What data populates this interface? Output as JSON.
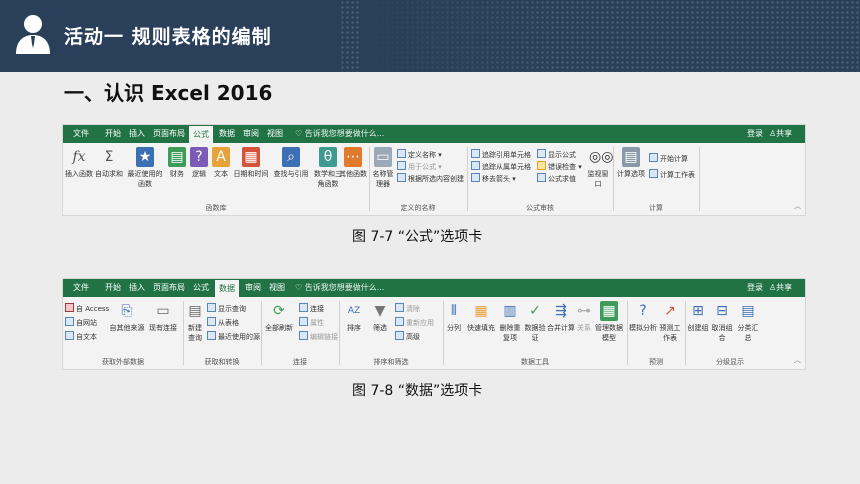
{
  "header": {
    "title": "活动一  规则表格的编制",
    "avatar_icon": "user-icon"
  },
  "section_title": "一、认识 Excel 2016",
  "ribbon1": {
    "tabs": [
      "文件",
      "开始",
      "插入",
      "页面布局",
      "公式",
      "数据",
      "审阅",
      "视图"
    ],
    "active_tab": "公式",
    "tell_me": "告诉我您想要做什么...",
    "login": "登录",
    "share": "共享",
    "buttons": [
      {
        "label": "插入函数",
        "icon": "fx",
        "color": "#555555"
      },
      {
        "label": "自动求和",
        "icon": "Σ",
        "color": "#555555"
      },
      {
        "label": "最近使用的函数",
        "icon": "★",
        "color": "#3d6fb5"
      },
      {
        "label": "财务",
        "icon": "▤",
        "color": "#3f9b5a"
      },
      {
        "label": "逻辑",
        "icon": "?",
        "color": "#7b5bb5"
      },
      {
        "label": "文本",
        "icon": "A",
        "color": "#e8a23a"
      },
      {
        "label": "日期和时间",
        "icon": "▦",
        "color": "#d4543a"
      },
      {
        "label": "查找与引用",
        "icon": "⌕",
        "color": "#3d6fb5"
      },
      {
        "label": "数学和三角函数",
        "icon": "θ",
        "color": "#3f9b8f"
      },
      {
        "label": "其他函数",
        "icon": "⋯",
        "color": "#e07a2e"
      }
    ],
    "names": {
      "manager": "名称管理器",
      "define": "定义名称",
      "use": "用于公式",
      "create": "根据所选内容创建"
    },
    "audit": [
      "追踪引用单元格",
      "追踪从属单元格",
      "移去箭头",
      "显示公式",
      "错误检查",
      "公式求值"
    ],
    "watch": "监视窗口",
    "calc": {
      "options": "计算选项",
      "calc_now": "开始计算",
      "calc_sheet": "计算工作表"
    },
    "groups": [
      "函数库",
      "定义的名称",
      "公式审核",
      "计算"
    ],
    "caption": "图 7-7  “公式”选项卡"
  },
  "ribbon2": {
    "tabs": [
      "文件",
      "开始",
      "插入",
      "页面布局",
      "公式",
      "数据",
      "审阅",
      "视图"
    ],
    "active_tab": "数据",
    "tell_me": "告诉我您想要做什么...",
    "login": "登录",
    "share": "共享",
    "external": [
      "自 Access",
      "自网站",
      "自文本"
    ],
    "other_sources": "自其他来源",
    "existing": "现有连接",
    "new_query": "新建查询",
    "query_items": [
      "显示查询",
      "从表格",
      "最近使用的源"
    ],
    "refresh_all": "全部刷新",
    "conn_items": [
      "连接",
      "属性",
      "编辑链接"
    ],
    "sort": "排序",
    "filter": "筛选",
    "filter_items": [
      "清除",
      "重新应用",
      "高级"
    ],
    "tools": [
      "分列",
      "快速填充",
      "删除重复项",
      "数据验证",
      "合并计算",
      "关系",
      "管理数据模型"
    ],
    "forecast": [
      "模拟分析",
      "预测工作表"
    ],
    "outline": [
      "创建组",
      "取消组合",
      "分类汇总"
    ],
    "groups": [
      "获取外部数据",
      "获取和转换",
      "连接",
      "排序和筛选",
      "数据工具",
      "预测",
      "分级显示"
    ],
    "caption": "图 7-8  “数据”选项卡"
  }
}
